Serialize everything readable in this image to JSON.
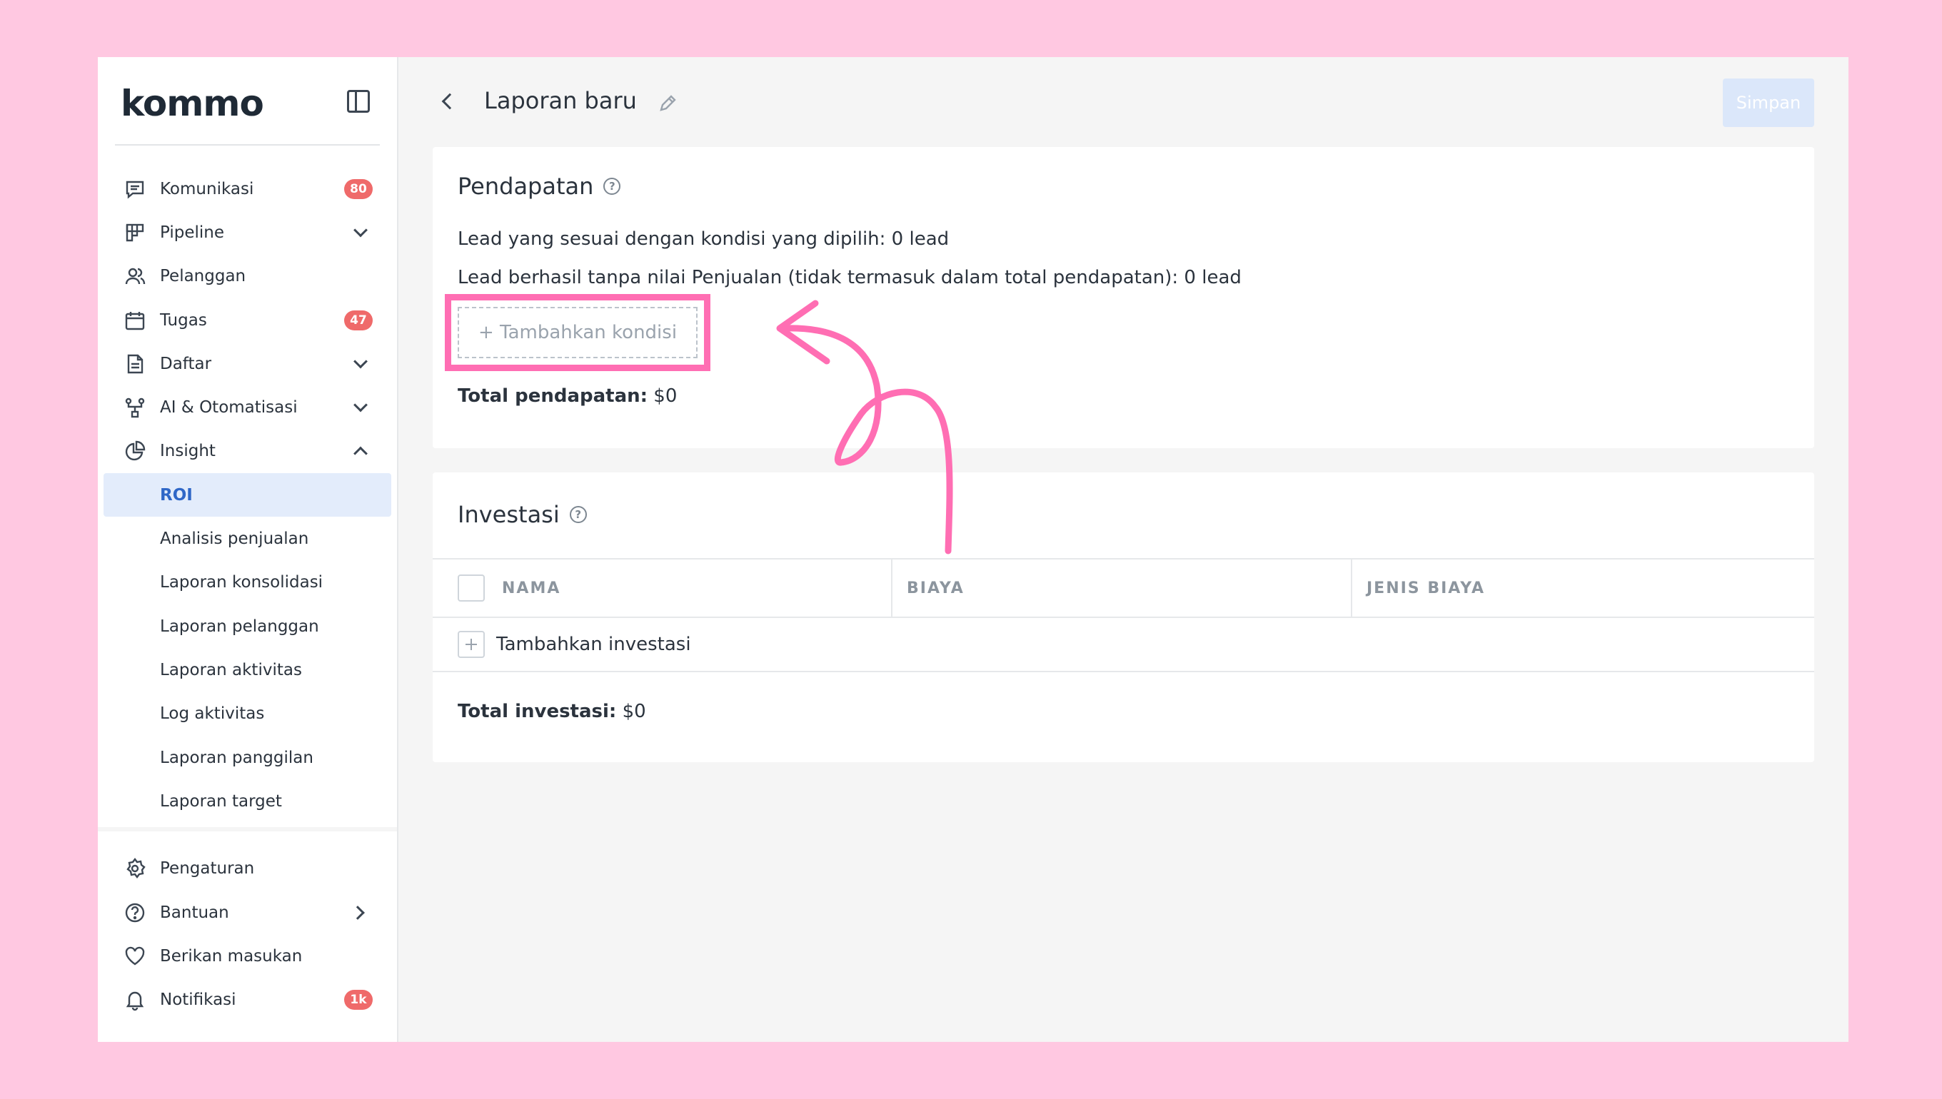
{
  "app": {
    "logo": "kommo"
  },
  "sidebar": {
    "items": [
      {
        "label": "Komunikasi",
        "icon": "chat-icon",
        "badge": "80"
      },
      {
        "label": "Pipeline",
        "icon": "pipeline-icon"
      },
      {
        "label": "Pelanggan",
        "icon": "users-icon"
      },
      {
        "label": "Tugas",
        "icon": "calendar-icon",
        "badge": "47"
      },
      {
        "label": "Daftar",
        "icon": "document-icon"
      },
      {
        "label": "AI & Otomatisasi",
        "icon": "automation-icon"
      },
      {
        "label": "Insight",
        "icon": "pie-chart-icon"
      }
    ],
    "insight_sub": [
      {
        "label": "ROI",
        "active": true
      },
      {
        "label": "Analisis penjualan"
      },
      {
        "label": "Laporan konsolidasi"
      },
      {
        "label": "Laporan pelanggan"
      },
      {
        "label": "Laporan aktivitas"
      },
      {
        "label": "Log aktivitas"
      },
      {
        "label": "Laporan panggilan"
      },
      {
        "label": "Laporan target"
      }
    ],
    "bottom": [
      {
        "label": "Pengaturan",
        "icon": "gear-icon"
      },
      {
        "label": "Bantuan",
        "icon": "help-circle-icon"
      },
      {
        "label": "Berikan masukan",
        "icon": "heart-icon"
      },
      {
        "label": "Notifikasi",
        "icon": "bell-icon",
        "badge": "1k"
      }
    ]
  },
  "header": {
    "title": "Laporan baru",
    "save_label": "Simpan"
  },
  "revenue": {
    "title": "Pendapatan",
    "help": "?",
    "line1": "Lead yang sesuai dengan kondisi yang dipilih: 0 lead",
    "line2": "Lead berhasil tanpa nilai Penjualan (tidak termasuk dalam total pendapatan): 0 lead",
    "add_condition": "+ Tambahkan kondisi",
    "total_label": "Total pendapatan:",
    "total_value": " $0"
  },
  "investment": {
    "title": "Investasi",
    "help": "?",
    "columns": [
      "NAMA",
      "BIAYA",
      "JENIS BIAYA"
    ],
    "add_label": "Tambahkan investasi",
    "total_label": "Total investasi:",
    "total_value": " $0"
  },
  "colors": {
    "background": "#ffc8e1",
    "highlight": "#ff6eb3",
    "badge": "#ef6a6a",
    "active": "#2f67c7",
    "save_disabled": "#dbe7fa"
  }
}
